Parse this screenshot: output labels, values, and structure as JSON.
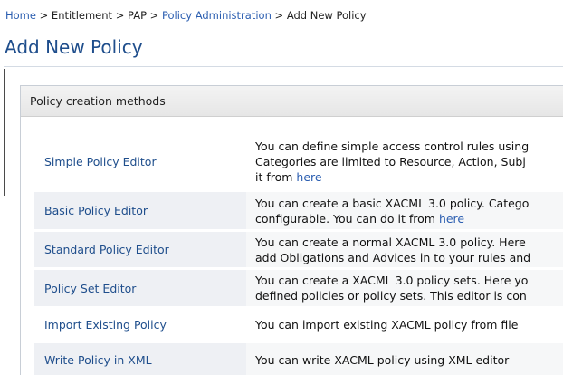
{
  "breadcrumb": {
    "home": "Home",
    "sep": " > ",
    "entitlement": "Entitlement",
    "pap": "PAP",
    "policy_admin": "Policy Administration",
    "current": "Add New Policy"
  },
  "page_title": "Add New Policy",
  "panel": {
    "header": "Policy creation methods",
    "rows": [
      {
        "name": "Simple Policy Editor",
        "desc_lines": [
          "You can define simple access control rules using",
          "Categories are limited to Resource, Action, Subj",
          "it from "
        ],
        "link": "here"
      },
      {
        "name": "Basic Policy Editor",
        "desc_lines": [
          "You can create a basic XACML 3.0 policy. Catego",
          "configurable. You can do it from "
        ],
        "link": "here"
      },
      {
        "name": "Standard Policy Editor",
        "desc_lines": [
          "You can create a normal XACML 3.0 policy. Here",
          "add Obligations and Advices in to your rules and"
        ]
      },
      {
        "name": "Policy Set Editor",
        "desc_lines": [
          "You can create a XACML 3.0 policy sets. Here yo",
          "defined policies or policy sets. This editor is con"
        ]
      },
      {
        "name": "Import Existing Policy",
        "desc_lines": [
          "You can import existing XACML policy from file"
        ]
      },
      {
        "name": "Write Policy in XML",
        "desc_lines": [
          "You can write XACML policy using XML editor"
        ]
      }
    ]
  },
  "colors": {
    "link": "#2a5db0",
    "title": "#1f4e8c",
    "name_bg": "#eef0f4",
    "desc_bg": "#f6f7f8"
  }
}
